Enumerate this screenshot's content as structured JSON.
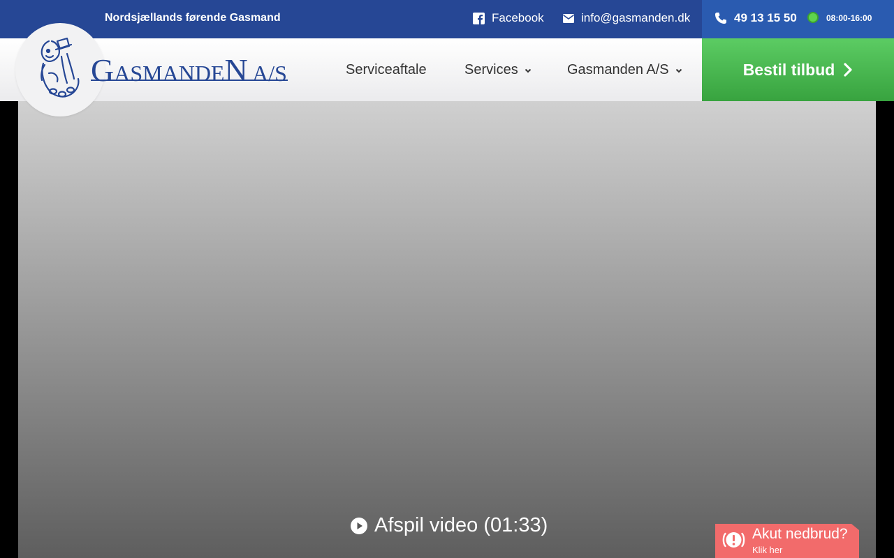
{
  "topbar": {
    "tagline": "Nordsjællands førende Gasmand",
    "facebook_label": "Facebook",
    "email": "info@gasmanden.dk",
    "phone": "49 13 15 50",
    "hours": "08:00-16:00",
    "open_status_color": "#5fd44d"
  },
  "logo": {
    "first_letter": "G",
    "middle": "ASMANDE",
    "big_letter": "N",
    "suffix": "A/S",
    "color": "#264795"
  },
  "nav": {
    "items": [
      {
        "label": "Serviceaftale",
        "has_dropdown": false
      },
      {
        "label": "Services",
        "has_dropdown": true
      },
      {
        "label": "Gasmanden A/S",
        "has_dropdown": true
      }
    ],
    "cta_label": "Bestil tilbud"
  },
  "hero": {
    "play_label": "Afspil video (01:33)"
  },
  "emergency": {
    "title": "Akut nedbrud?",
    "subtitle": "Klik her",
    "color": "#f26b6b"
  },
  "colors": {
    "brand_blue": "#264795",
    "phone_blue": "#2a5bb0",
    "cta_green": "#4cbf53"
  },
  "icons": [
    "facebook-icon",
    "envelope-icon",
    "phone-icon",
    "status-dot-icon",
    "chevron-down-icon",
    "chevron-right-icon",
    "play-icon",
    "alert-icon",
    "logo-mascot-icon"
  ]
}
